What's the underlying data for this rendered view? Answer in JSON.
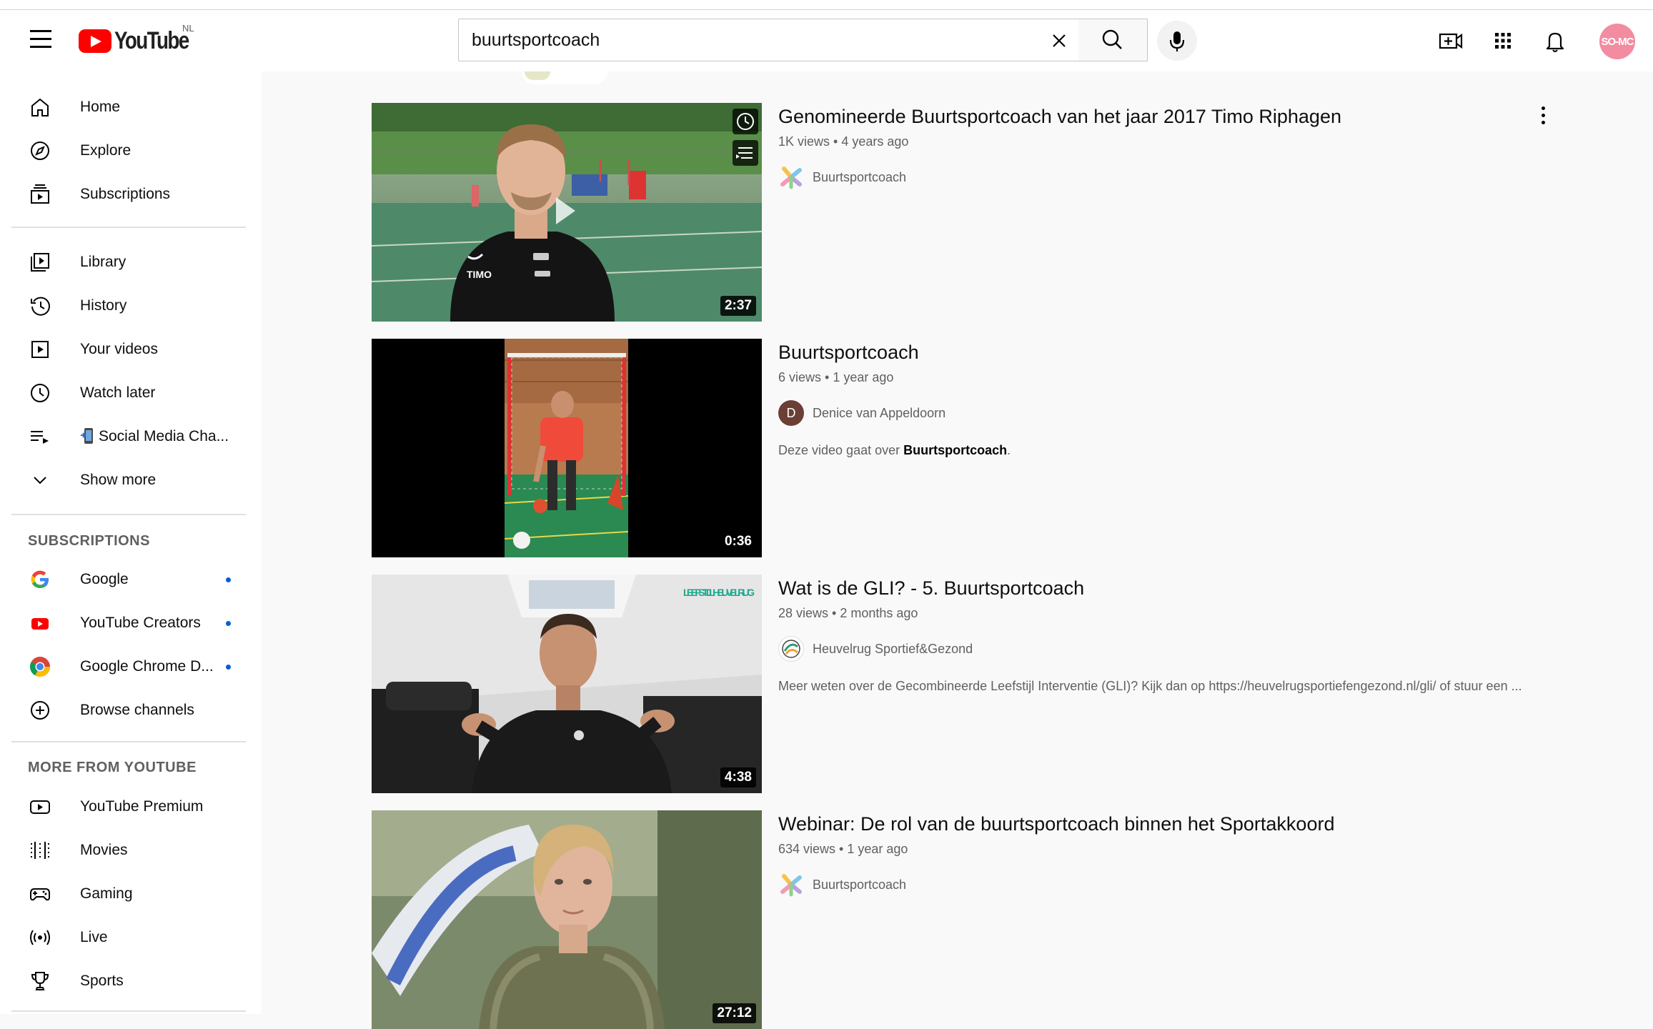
{
  "header": {
    "country_code": "NL",
    "logo_text": "YouTube",
    "search_value": "buurtsportcoach",
    "avatar_text": "SO-MC"
  },
  "sidebar": {
    "main": [
      {
        "label": "Home",
        "icon": "home-icon"
      },
      {
        "label": "Explore",
        "icon": "compass-icon"
      },
      {
        "label": "Subscriptions",
        "icon": "subscriptions-icon"
      }
    ],
    "library": [
      {
        "label": "Library",
        "icon": "library-icon"
      },
      {
        "label": "History",
        "icon": "history-icon"
      },
      {
        "label": "Your videos",
        "icon": "your-videos-icon"
      },
      {
        "label": "Watch later",
        "icon": "clock-icon"
      },
      {
        "label": "Social Media Cha...",
        "icon": "playlist-icon"
      },
      {
        "label": "Show more",
        "icon": "chevron-down-icon"
      }
    ],
    "subscriptions_title": "SUBSCRIPTIONS",
    "subscriptions": [
      {
        "label": "Google",
        "icon": "google-icon"
      },
      {
        "label": "YouTube Creators",
        "icon": "youtube-creators-icon"
      },
      {
        "label": "Google Chrome D...",
        "icon": "chrome-icon"
      },
      {
        "label": "Browse channels",
        "icon": "add-circle-icon"
      }
    ],
    "more_title": "MORE FROM YOUTUBE",
    "more": [
      {
        "label": "YouTube Premium",
        "icon": "premium-icon"
      },
      {
        "label": "Movies",
        "icon": "film-icon"
      },
      {
        "label": "Gaming",
        "icon": "gamepad-icon"
      },
      {
        "label": "Live",
        "icon": "live-icon"
      },
      {
        "label": "Sports",
        "icon": "trophy-icon"
      }
    ]
  },
  "results": [
    {
      "title": "Genomineerde Buurtsportcoach van het jaar 2017 Timo Riphagen",
      "meta": "1K views • 4 years ago",
      "channel": "Buurtsportcoach",
      "duration": "2:37",
      "description": "",
      "description_bold": "",
      "description_end": ""
    },
    {
      "title": "Buurtsportcoach",
      "meta": "6 views • 1 year ago",
      "channel": "Denice van Appeldoorn",
      "channel_initial": "D",
      "duration": "0:36",
      "description": "Deze video gaat over ",
      "description_bold": "Buurtsportcoach",
      "description_end": "."
    },
    {
      "title": "Wat is de GLI? - 5. Buurtsportcoach",
      "meta": "28 views • 2 months ago",
      "channel": "Heuvelrug Sportief&Gezond",
      "duration": "4:38",
      "thumb_caption": "LEEFSTIJL HEUVELRUG",
      "description": "Meer weten over de Gecombineerde Leefstijl Interventie (GLI)? Kijk dan op https://heuvelrugsportiefengezond.nl/gli/ of stuur een ...",
      "description_bold": "",
      "description_end": ""
    },
    {
      "title": "Webinar: De rol van de buurtsportcoach binnen het Sportakkoord",
      "meta": "634 views • 1 year ago",
      "channel": "Buurtsportcoach",
      "duration": "27:12",
      "description": "",
      "description_bold": "",
      "description_end": ""
    }
  ],
  "thumb1_shirt_text": "TIMO",
  "colors": {
    "brand": "#ff0000",
    "accent_dot": "#065fd4",
    "avatar_bg": "#f28ca0"
  }
}
